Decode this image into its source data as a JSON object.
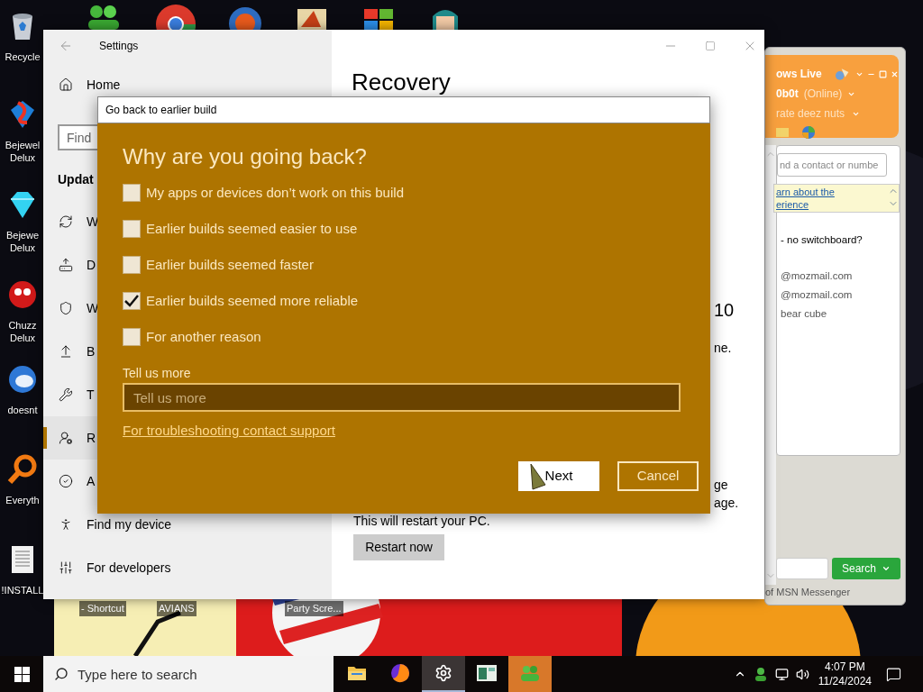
{
  "desktop": {
    "icons": [
      {
        "lines": [
          "Recycle"
        ]
      },
      {
        "lines": [
          "Bejewel",
          "Delux"
        ]
      },
      {
        "lines": [
          "Bejewe",
          "Delux"
        ]
      },
      {
        "lines": [
          "Chuzz",
          "Delux"
        ]
      },
      {
        "lines": [
          "doesnt"
        ]
      },
      {
        "lines": [
          "Everyth"
        ]
      },
      {
        "lines": [
          "!INSTALL"
        ]
      }
    ],
    "bottom_labels": [
      "- Shortcut",
      "AVIANS",
      "Party Scre..."
    ]
  },
  "settings": {
    "title": "Settings",
    "home": "Home",
    "search": {
      "placeholder": "Find"
    },
    "section": "Updat",
    "items": [
      {
        "label": "W",
        "selected": false
      },
      {
        "label": "D",
        "selected": false
      },
      {
        "label": "W",
        "selected": false
      },
      {
        "label": "B",
        "selected": false
      },
      {
        "label": "T",
        "selected": false
      },
      {
        "label": "R",
        "selected": true
      },
      {
        "label": "A",
        "selected": false
      },
      {
        "label": "Find my device",
        "selected": false
      },
      {
        "label": "For developers",
        "selected": false
      }
    ],
    "page_title": "Recovery",
    "fragments": [
      "10",
      "ne.",
      "ge",
      "age."
    ],
    "restart_note": "This will restart your PC.",
    "restart_button": "Restart now"
  },
  "dialog": {
    "title": "Go back to earlier build",
    "heading": "Why are you going back?",
    "reasons": [
      {
        "label": "My apps or devices don’t work on this build",
        "checked": false
      },
      {
        "label": "Earlier builds seemed easier to use",
        "checked": false
      },
      {
        "label": "Earlier builds seemed faster",
        "checked": false
      },
      {
        "label": "Earlier builds seemed more reliable",
        "checked": true
      },
      {
        "label": "For another reason",
        "checked": false
      }
    ],
    "more_label": "Tell us more",
    "more_field": {
      "placeholder": "Tell us more"
    },
    "support_link": "For troubleshooting contact support",
    "buttons": [
      {
        "label": "Next",
        "kind": "primary"
      },
      {
        "label": "Cancel",
        "kind": "secondary"
      }
    ]
  },
  "messenger": {
    "brand": "ows Live",
    "user": "0b0t",
    "status": "(Online)",
    "message": "rate deez nuts",
    "search": {
      "placeholder": "nd a contact or numbe"
    },
    "ad_links": [
      "arn about the",
      "erience"
    ],
    "contacts": [
      "- no switchboard?",
      "@mozmail.com",
      "@mozmail.com",
      "bear cube"
    ],
    "search_button": "Search",
    "footer": "of MSN Messenger"
  },
  "taskbar": {
    "search": {
      "placeholder": "Type here to search"
    },
    "apps": [
      {
        "selected": false,
        "flashing": false
      },
      {
        "selected": false,
        "flashing": false
      },
      {
        "selected": true,
        "flashing": false
      },
      {
        "selected": false,
        "flashing": false
      },
      {
        "selected": false,
        "flashing": true
      }
    ],
    "time": "4:07 PM",
    "date": "11/24/2024"
  }
}
